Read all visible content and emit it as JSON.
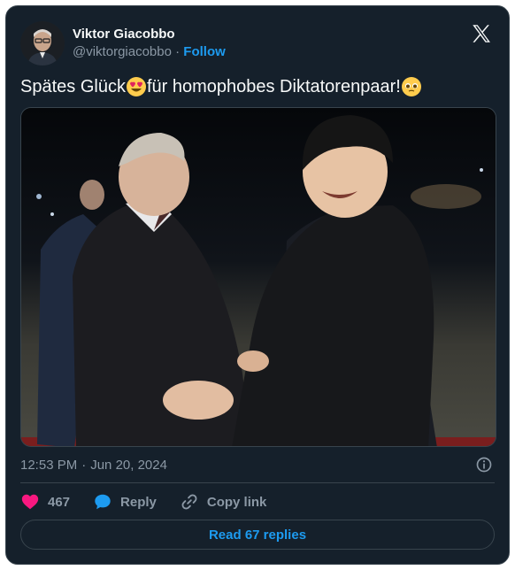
{
  "author": {
    "display_name": "Viktor Giacobbo",
    "handle": "@viktorgiacobbo",
    "separator": "·",
    "follow_label": "Follow"
  },
  "tweet": {
    "text_part1": "Spätes Glück",
    "text_part2": "für homophobes Diktatorenpaar!",
    "emoji_1": "heart-eyes-emoji",
    "emoji_2": "pleading-face-emoji"
  },
  "media": {
    "description_icon": "photo"
  },
  "meta": {
    "time": "12:53 PM",
    "dot": "·",
    "date": "Jun 20, 2024"
  },
  "actions": {
    "like_count": "467",
    "reply_label": "Reply",
    "copy_label": "Copy link"
  },
  "footer": {
    "read_replies_label": "Read 67 replies"
  },
  "colors": {
    "background": "#15202b",
    "accent": "#1d9bf0",
    "like": "#f91880",
    "muted": "#8b98a5"
  }
}
